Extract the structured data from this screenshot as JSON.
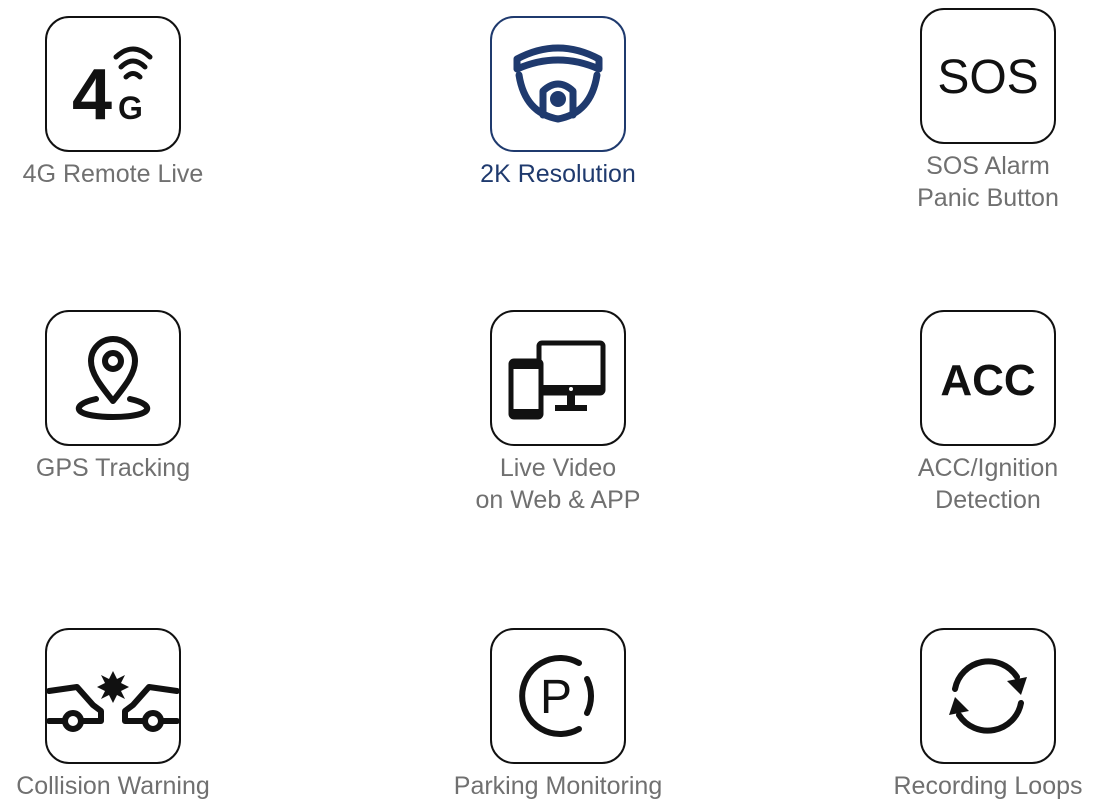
{
  "colors": {
    "icon": "#111111",
    "label": "#707070",
    "active": "#1f3a6e"
  },
  "features": [
    {
      "label": "4G Remote Live",
      "icon": "4g-signal-icon",
      "active": false
    },
    {
      "label": "2K Resolution",
      "icon": "dome-camera-icon",
      "active": true
    },
    {
      "label": "SOS Alarm\nPanic Button",
      "icon": "sos-icon",
      "active": false
    },
    {
      "label": "GPS Tracking",
      "icon": "map-pin-icon",
      "active": false
    },
    {
      "label": "Live Video\non Web & APP",
      "icon": "devices-icon",
      "active": false
    },
    {
      "label": "ACC/Ignition\nDetection",
      "icon": "acc-icon",
      "active": false
    },
    {
      "label": "Collision Warning",
      "icon": "car-collision-icon",
      "active": false
    },
    {
      "label": "Parking Monitoring",
      "icon": "parking-icon",
      "active": false
    },
    {
      "label": "Recording Loops",
      "icon": "loop-arrows-icon",
      "active": false
    }
  ],
  "icon_text": {
    "four_g_main": "4",
    "four_g_sub": "G",
    "sos": "SOS",
    "acc": "ACC",
    "parking": "P"
  }
}
